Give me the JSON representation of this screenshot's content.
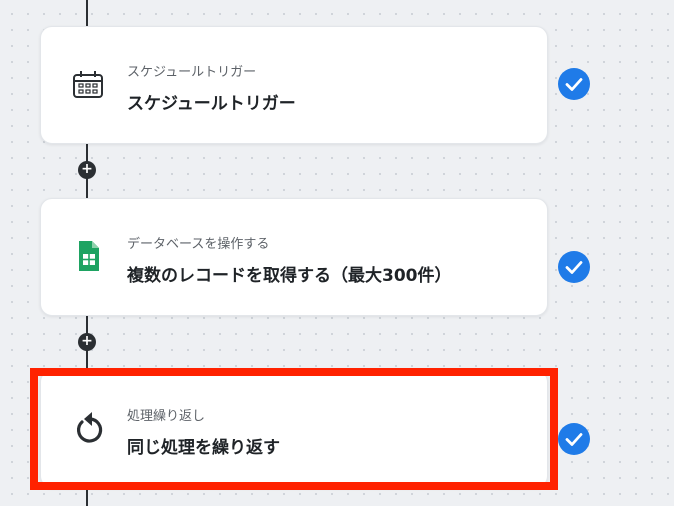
{
  "steps": [
    {
      "subtitle": "スケジュールトリガー",
      "title": "スケジュールトリガー",
      "icon": "schedule-calendar-icon",
      "status": "completed"
    },
    {
      "subtitle": "データベースを操作する",
      "title": "複数のレコードを取得する（最大300件）",
      "icon": "google-sheets-icon",
      "status": "completed"
    },
    {
      "subtitle": "処理繰り返し",
      "title": "同じ処理を繰り返す",
      "icon": "loop-arrow-icon",
      "status": "completed"
    }
  ],
  "add_step_label": "+",
  "colors": {
    "check": "#1f7be8",
    "highlight": "#ff2200",
    "connector": "#2b2f33",
    "sheets_green": "#1ea362"
  }
}
